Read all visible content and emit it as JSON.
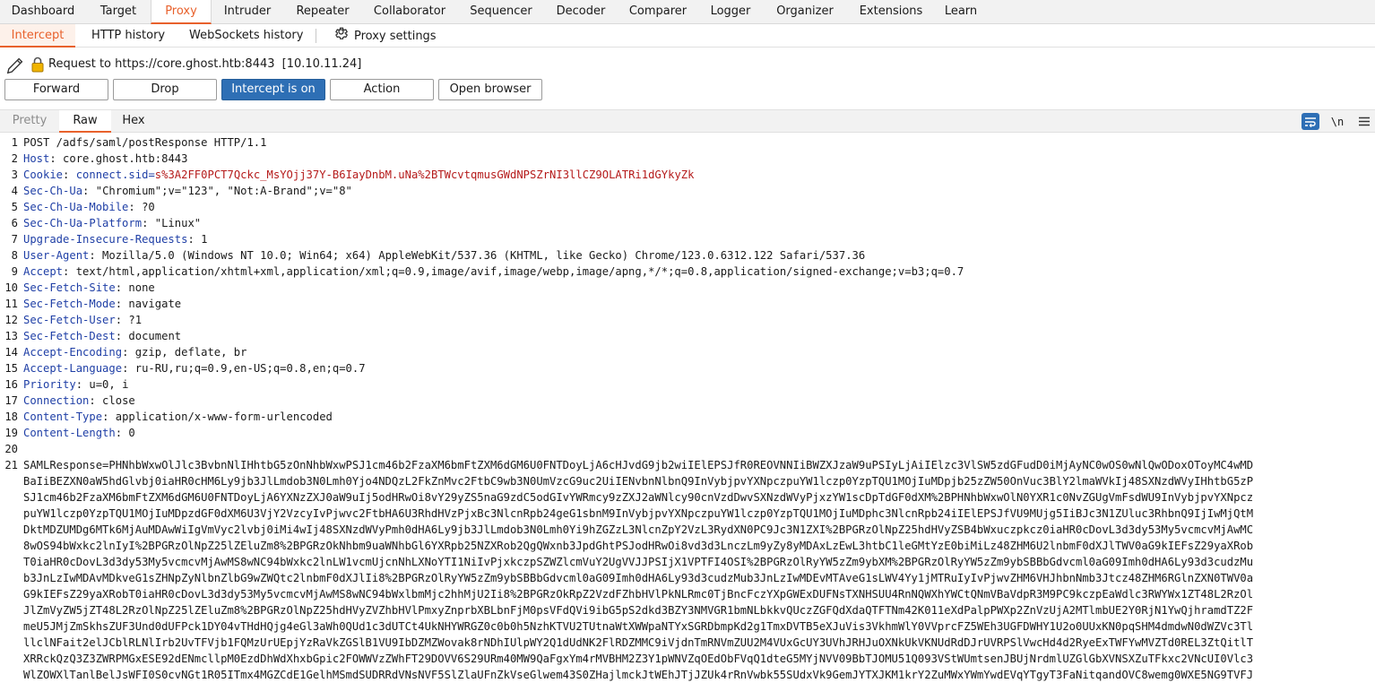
{
  "main_tabs": [
    "Dashboard",
    "Target",
    "Proxy",
    "Intruder",
    "Repeater",
    "Collaborator",
    "Sequencer",
    "Decoder",
    "Comparer",
    "Logger",
    "Organizer",
    "Extensions",
    "Learn"
  ],
  "sub_tabs": {
    "intercept": "Intercept",
    "http_history": "HTTP history",
    "websockets_history": "WebSockets history",
    "proxy_settings": "Proxy settings"
  },
  "request_info": {
    "text": "Request to https://core.ghost.htb:8443",
    "ip": "[10.10.11.24]"
  },
  "buttons": {
    "forward": "Forward",
    "drop": "Drop",
    "intercept": "Intercept is on",
    "action": "Action",
    "open_browser": "Open browser"
  },
  "editor_tabs": {
    "pretty": "Pretty",
    "raw": "Raw",
    "hex": "Hex",
    "newline_toggle": "\\n"
  },
  "accent_color": "#e8612c",
  "primary_button_color": "#2e6fb5",
  "request_lines": [
    {
      "n": "1",
      "name": "",
      "value": "POST /adfs/saml/postResponse HTTP/1.1"
    },
    {
      "n": "2",
      "name": "Host",
      "value": " core.ghost.htb:8443"
    },
    {
      "n": "3",
      "name": "Cookie",
      "cookie_name": "connect.sid",
      "cookie_value": "s%3A2FF0PCT7Qckc_MsYOjj37Y-B6IayDnbM.uNa%2BTWcvtqmusGWdNPSZrNI3llCZ9OLATRi1dGYkyZk"
    },
    {
      "n": "4",
      "name": "Sec-Ch-Ua",
      "value": " \"Chromium\";v=\"123\", \"Not:A-Brand\";v=\"8\""
    },
    {
      "n": "5",
      "name": "Sec-Ch-Ua-Mobile",
      "value": " ?0"
    },
    {
      "n": "6",
      "name": "Sec-Ch-Ua-Platform",
      "value": " \"Linux\""
    },
    {
      "n": "7",
      "name": "Upgrade-Insecure-Requests",
      "value": " 1"
    },
    {
      "n": "8",
      "name": "User-Agent",
      "value": " Mozilla/5.0 (Windows NT 10.0; Win64; x64) AppleWebKit/537.36 (KHTML, like Gecko) Chrome/123.0.6312.122 Safari/537.36"
    },
    {
      "n": "9",
      "name": "Accept",
      "value": " text/html,application/xhtml+xml,application/xml;q=0.9,image/avif,image/webp,image/apng,*/*;q=0.8,application/signed-exchange;v=b3;q=0.7"
    },
    {
      "n": "10",
      "name": "Sec-Fetch-Site",
      "value": " none"
    },
    {
      "n": "11",
      "name": "Sec-Fetch-Mode",
      "value": " navigate"
    },
    {
      "n": "12",
      "name": "Sec-Fetch-User",
      "value": " ?1"
    },
    {
      "n": "13",
      "name": "Sec-Fetch-Dest",
      "value": " document"
    },
    {
      "n": "14",
      "name": "Accept-Encoding",
      "value": " gzip, deflate, br"
    },
    {
      "n": "15",
      "name": "Accept-Language",
      "value": " ru-RU,ru;q=0.9,en-US;q=0.8,en;q=0.7"
    },
    {
      "n": "16",
      "name": "Priority",
      "value": " u=0, i"
    },
    {
      "n": "17",
      "name": "Connection",
      "value": " close"
    },
    {
      "n": "18",
      "name": "Content-Type",
      "value": " application/x-www-form-urlencoded"
    },
    {
      "n": "19",
      "name": "Content-Length",
      "value": " 0"
    },
    {
      "n": "20",
      "name": "",
      "value": ""
    }
  ],
  "body_line_number": "21",
  "body_lines": [
    "SAMLResponse=PHNhbWxwOlJlc3BvbnNlIHhtbG5zOnNhbWxwPSJ1cm46b2FzaXM6bmFtZXM6dGM6U0FNTDoyLjA6cHJvdG9jb2wiIElEPSJfR0REOVNNIiBWZXJzaW9uPSIyLjAiIElzc3VlSW5zdGFudD0iMjAyNC0wOS0wNlQwODoxOToyMC4wMD",
    "BaIiBEZXN0aW5hdGlvbj0iaHR0cHM6Ly9jb3JlLmdob3N0Lmh0Yjo4NDQzL2FkZnMvc2FtbC9wb3N0UmVzcG9uc2UiIENvbnNlbnQ9InVybjpvYXNpczpuYW1lczp0YzpTQU1MOjIuMDpjb25zZW50OnVuc3BlY2lmaWVkIj48SXNzdWVyIHhtbG5zP",
    "SJ1cm46b2FzaXM6bmFtZXM6dGM6U0FNTDoyLjA6YXNzZXJ0aW9uIj5odHRwOi8vY29yZS5naG9zdC5odGIvYWRmcy9zZXJ2aWNlcy90cnVzdDwvSXNzdWVyPjxzYW1scDpTdGF0dXM%2BPHNhbWxwOlN0YXR1c0NvZGUgVmFsdWU9InVybjpvYXNpcz",
    "puYW1lczp0YzpTQU1MOjIuMDpzdGF0dXM6U3VjY2VzcyIvPjwvc2FtbHA6U3RhdHVzPjxBc3NlcnRpb24geG1sbnM9InVybjpvYXNpczpuYW1lczp0YzpTQU1MOjIuMDphc3NlcnRpb24iIElEPSJfVU9MUjg5IiBJc3N1ZUluc3RhbnQ9IjIwMjQtM",
    "DktMDZUMDg6MTk6MjAuMDAwWiIgVmVyc2lvbj0iMi4wIj48SXNzdWVyPmh0dHA6Ly9jb3JlLmdob3N0Lmh0Yi9hZGZzL3NlcnZpY2VzL3RydXN0PC9Jc3N1ZXI%2BPGRzOlNpZ25hdHVyZSB4bWxuczpkcz0iaHR0cDovL3d3dy53My5vcmcvMjAwMC",
    "8wOS94bWxkc2lnIyI%2BPGRzOlNpZ25lZEluZm8%2BPGRzOkNhbm9uaWNhbGl6YXRpb25NZXRob2QgQWxnb3JpdGhtPSJodHRwOi8vd3d3LnczLm9yZy8yMDAxLzEwL3htbC1leGMtYzE0biMiLz48ZHM6U2lnbmF0dXJlTWV0aG9kIEFsZ29yaXRob",
    "T0iaHR0cDovL3d3dy53My5vcmcvMjAwMS8wNC94bWxkc2lnLW1vcmUjcnNhLXNoYTI1NiIvPjxkczpSZWZlcmVuY2UgVVJJPSIjX1VPTFI4OSI%2BPGRzOlRyYW5zZm9ybXM%2BPGRzOlRyYW5zZm9ybSBBbGdvcml0aG09Imh0dHA6Ly93d3cudzMu",
    "b3JnLzIwMDAvMDkveG1sZHNpZyNlbnZlbG9wZWQtc2lnbmF0dXJlIi8%2BPGRzOlRyYW5zZm9ybSBBbGdvcml0aG09Imh0dHA6Ly93d3cudzMub3JnLzIwMDEvMTAveG1sLWV4Yy1jMTRuIyIvPjwvZHM6VHJhbnNmb3Jtcz48ZHM6RGlnZXN0TWV0a",
    "G9kIEFsZ29yaXRobT0iaHR0cDovL3d3dy53My5vcmcvMjAwMS8wNC94bWxlbmMjc2hhMjU2Ii8%2BPGRzOkRpZ2VzdFZhbHVlPkNLRmc0TjBncFczYXpGWExDUFNsTXNHSUU4RnNQWXhYWCtQNmVBaVdpR3M9PC9kczpEaWdlc3RWYWx1ZT48L2RzOl",
    "JlZmVyZW5jZT48L2RzOlNpZ25lZEluZm8%2BPGRzOlNpZ25hdHVyZVZhbHVlPmxyZnprbXBLbnFjM0psVFdQVi9ibG5pS2dkd3BZY3NMVGR1bmNLbkkvQUczZGFQdXdaQTFTNm42K011eXdPalpPWXp2ZnVzUjA2MTlmbUE2Y0RjN1YwQjhramdTZ2F",
    "meU5JMjZmSkhsZUF3Und0dUFPck1DY04vTHdHQjg4eGl3aWh0QUd1c3dUTCt4UkNHYWRGZ0c0b0h5NzhKTVU2TUtnaWtXWWpaNTYxSGRDbmpKd2g1TmxDVTB5eXJuVis3VkhmWlY0VVprcFZ5WEh3UGFDWHY1U2o0UUxKN0pqSHM4dmdwN0dWZVc3Tl",
    "llclNFait2elJCblRLNlIrb2UvTFVjb1FQMzUrUEpjYzRaVkZGSlB1VU9IbDZMZWovak8rNDhIUlpWY2Q1dUdNK2FlRDZMMC9iVjdnTmRNVmZUU2M4VUxGcUY3UVhJRHJuOXNkUkVKNUdRdDJrUVRPSlVwcHd4d2RyeExTWFYwMVZTd0REL3ZtQitlT",
    "XRRckQzQ3Z3ZWRPMGxESE92dENmcllpM0EzdDhWdXhxbGpic2FOWWVzZWhFT29DOVV6S29URm40MW9QaFgxYm4rMVBHM2Z3Y1pWNVZqOEdObFVqQ1dteG5MYjNVV09BbTJOMU51Q093VStWUmtsenJBUjNrdmlUZGlGbXVNSXZuTFkxc2VNcUI0Vlc3",
    "WlZOWXlTanlBelJsWFI0S0cvNGt1R05ITmx4MGZCdE1GelhMSmdSUDRRdVNsNVF5SlZlaUFnZkVseGlwem43S0ZHajlmckJtWEhJTjJZUk4rRnVwbk55SUdxVk9GemJYTXJKM1krY2ZuMWxYWmYwdEVqYTgyT3FaNitqandOVC8wemg0WXE5NG9TVFJ"
  ]
}
